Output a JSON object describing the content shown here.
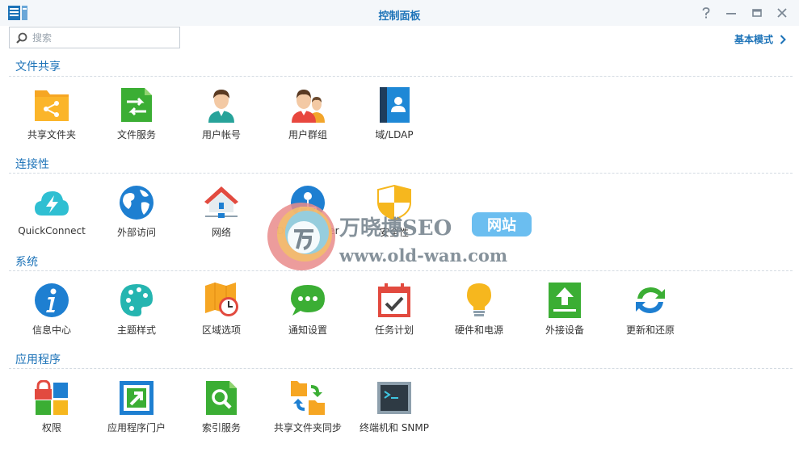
{
  "window": {
    "title": "控制面板"
  },
  "search": {
    "placeholder": "搜索"
  },
  "mode": {
    "label": "基本模式"
  },
  "sections": [
    {
      "title": "文件共享",
      "items": [
        "共享文件夹",
        "文件服务",
        "用户帐号",
        "用户群组",
        "域/LDAP"
      ]
    },
    {
      "title": "连接性",
      "items": [
        "QuickConnect",
        "外部访问",
        "网络",
        "DHCP Server",
        "安全性"
      ]
    },
    {
      "title": "系统",
      "items": [
        "信息中心",
        "主题样式",
        "区域选项",
        "通知设置",
        "任务计划",
        "硬件和电源",
        "外接设备",
        "更新和还原"
      ]
    },
    {
      "title": "应用程序",
      "items": [
        "权限",
        "应用程序门户",
        "索引服务",
        "共享文件夹同步",
        "终端机和 SNMP"
      ]
    }
  ],
  "watermark": {
    "brand": "万晓博SEO",
    "badge": "网站",
    "url": "www.old-wan.com"
  }
}
